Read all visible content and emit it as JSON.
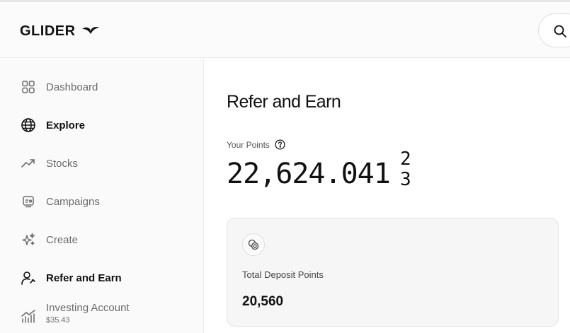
{
  "brand": {
    "name": "GLIDER"
  },
  "header": {
    "search_icon": "search-icon"
  },
  "sidebar": {
    "items": [
      {
        "label": "Dashboard",
        "icon": "grid-icon",
        "active": false
      },
      {
        "label": "Explore",
        "icon": "globe-icon",
        "active": true
      },
      {
        "label": "Stocks",
        "icon": "trend-up-icon",
        "active": false
      },
      {
        "label": "Campaigns",
        "icon": "campaign-icon",
        "active": false
      },
      {
        "label": "Create",
        "icon": "sparkles-icon",
        "active": false
      },
      {
        "label": "Refer and Earn",
        "icon": "user-refer-icon",
        "active": true
      },
      {
        "label": "Investing Account",
        "sub": "$35.43",
        "icon": "bar-chart-icon",
        "active": false
      }
    ]
  },
  "main": {
    "title": "Refer and Earn",
    "points_label": "Your Points",
    "points_value": "22,624.041",
    "points_roll_digits": [
      "2",
      "3"
    ],
    "card": {
      "icon": "coins-icon",
      "label": "Total Deposit Points",
      "value": "20,560"
    }
  },
  "colors": {
    "text_primary": "#111111",
    "text_muted": "#6b6b6b",
    "sidebar_bg": "#fafafa",
    "card_bg": "#f6f6f6"
  }
}
